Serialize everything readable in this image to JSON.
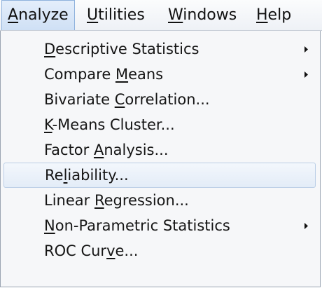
{
  "menubar": {
    "items": [
      {
        "pre": "",
        "u": "A",
        "post": "nalyze"
      },
      {
        "pre": "",
        "u": "U",
        "post": "tilities"
      },
      {
        "pre": "",
        "u": "W",
        "post": "indows"
      },
      {
        "pre": "",
        "u": "H",
        "post": "elp"
      }
    ]
  },
  "menu": {
    "items": [
      {
        "pre": "",
        "u": "D",
        "post": "escriptive Statistics"
      },
      {
        "pre": "Compare ",
        "u": "M",
        "post": "eans"
      },
      {
        "pre": "Bivariate ",
        "u": "C",
        "post": "orrelation..."
      },
      {
        "pre": "",
        "u": "K",
        "post": "-Means Cluster..."
      },
      {
        "pre": "Factor ",
        "u": "A",
        "post": "nalysis..."
      },
      {
        "pre": "Re",
        "u": "l",
        "post": "iability..."
      },
      {
        "pre": "Linear ",
        "u": "R",
        "post": "egression..."
      },
      {
        "pre": "",
        "u": "N",
        "post": "on-Parametric Statistics"
      },
      {
        "pre": "ROC Cur",
        "u": "v",
        "post": "e..."
      }
    ],
    "highlighted_index": 5,
    "submenu_arrow_icon": "triangle-right-icon"
  },
  "colors": {
    "highlight_border": "#b9cde6",
    "active_menubar_border": "#8fb2dd"
  }
}
